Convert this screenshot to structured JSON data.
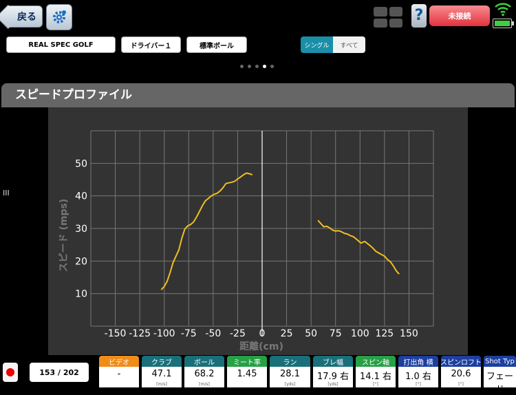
{
  "header": {
    "back_label": "戻る",
    "help_label": "?",
    "status_label": "未接続"
  },
  "selectors": {
    "product": "REAL SPEC GOLF",
    "club": "ドライバー１",
    "ball": "標準ボール",
    "mode_single": "シングル",
    "mode_all": "すべて"
  },
  "section_title": "スピードプロファイル",
  "side_handle": "III",
  "chart_data": {
    "type": "line",
    "xlabel": "距離(cm)",
    "ylabel": "スピード (mps)",
    "xlim": [
      -175,
      175
    ],
    "ylim": [
      0,
      60
    ],
    "xticks": [
      -150,
      -125,
      -100,
      -75,
      -50,
      -25,
      0,
      25,
      50,
      75,
      100,
      125,
      150
    ],
    "yticks": [
      10,
      20,
      30,
      40,
      50
    ],
    "grid": true,
    "series": [
      {
        "color": "#f0c020",
        "x": [
          -103,
          -100,
          -97,
          -94,
          -91,
          -88,
          -85,
          -82,
          -79,
          -76,
          -73,
          -70,
          -67,
          -64,
          -61,
          -58,
          -55,
          -52,
          -49,
          -46,
          -43,
          -40,
          -37,
          -34,
          -31,
          -28,
          -25,
          -22,
          -19,
          -16,
          -13,
          -10
        ],
        "y": [
          11.2,
          12.2,
          13.8,
          16.5,
          19.5,
          21.5,
          23.5,
          27,
          29.8,
          30.8,
          31.2,
          32,
          33.5,
          35.2,
          37,
          38.5,
          39.2,
          40,
          40.5,
          40.8,
          41.5,
          42.5,
          43.8,
          44,
          44.2,
          44.5,
          45.2,
          45.8,
          46.5,
          47,
          46.8,
          46.5
        ]
      },
      {
        "color": "#f0c020",
        "x": [
          57,
          60,
          63,
          66,
          69,
          72,
          75,
          78,
          81,
          84,
          87,
          90,
          93,
          96,
          99,
          101,
          103,
          105,
          107,
          110,
          113,
          116,
          119,
          122,
          125,
          128,
          131,
          134,
          137,
          140
        ],
        "y": [
          32.5,
          31.5,
          30.5,
          30.7,
          30.2,
          29.5,
          29.2,
          29.3,
          29,
          28.5,
          28.3,
          27.8,
          27.5,
          26.8,
          26,
          25.5,
          25.8,
          26,
          25.5,
          24.8,
          24,
          23,
          22.5,
          22,
          21.5,
          20.5,
          19.8,
          18.5,
          17,
          16
        ]
      }
    ]
  },
  "footer": {
    "count": "153 / 202",
    "metrics": [
      {
        "label": "ビデオ",
        "value": "-",
        "unit": "",
        "color": "#f08c1a"
      },
      {
        "label": "クラブ",
        "value": "47.1",
        "unit": "[m/s]",
        "color": "#19707a"
      },
      {
        "label": "ボール",
        "value": "68.2",
        "unit": "[m/s]",
        "color": "#19707a"
      },
      {
        "label": "ミート率",
        "value": "1.45",
        "unit": "",
        "color": "#27a046"
      },
      {
        "label": "ラン",
        "value": "28.1",
        "unit": "[yds]",
        "color": "#19707a"
      },
      {
        "label": "ブレ幅",
        "value": "17.9 右",
        "unit": "[yds]",
        "color": "#19707a"
      },
      {
        "label": "スピン軸",
        "value": "14.1 右",
        "unit": "[°]",
        "color": "#27a046"
      },
      {
        "label": "打出角 横",
        "value": "1.0 右",
        "unit": "[°]",
        "color": "#1c3fa0"
      },
      {
        "label": "スピンロフト",
        "value": "20.6",
        "unit": "[°]",
        "color": "#1c3fa0"
      },
      {
        "label": "Shot Typ",
        "value": "フェード",
        "unit": "",
        "color": "#1c3fa0"
      }
    ]
  }
}
